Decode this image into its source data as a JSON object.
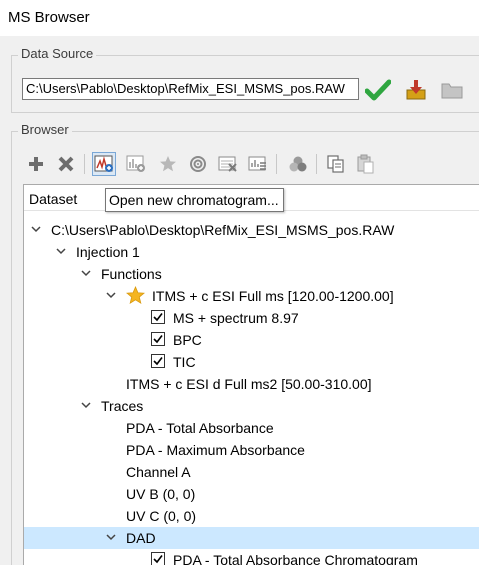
{
  "window": {
    "title": "MS Browser"
  },
  "data_source": {
    "legend": "Data Source",
    "path_value": "C:\\Users\\Pablo\\Desktop\\RefMix_ESI_MSMS_pos.RAW",
    "buttons": [
      {
        "icon": "checkmark-icon",
        "color": "#2fa640"
      },
      {
        "icon": "import-icon",
        "color": "#c0392b"
      },
      {
        "icon": "folder-icon",
        "color": "#b9b9b9"
      }
    ]
  },
  "browser": {
    "legend": "Browser",
    "toolbar": [
      {
        "icon": "add-icon"
      },
      {
        "icon": "remove-icon"
      },
      {
        "icon": "open-chromatogram-icon",
        "active": true
      },
      {
        "icon": "add-spectrum-icon"
      },
      {
        "icon": "star-icon"
      },
      {
        "icon": "target-icon"
      },
      {
        "icon": "delete-table-icon"
      },
      {
        "icon": "spectrum-list-icon"
      },
      {
        "icon": "group-icon"
      },
      {
        "icon": "copy-icon"
      },
      {
        "icon": "paste-icon"
      }
    ],
    "tooltip": "Open new chromatogram...",
    "tree": {
      "header": "Dataset",
      "nodes": [
        {
          "label": "C:\\Users\\Pablo\\Desktop\\RefMix_ESI_MSMS_pos.RAW",
          "expanded": true
        },
        {
          "label": "Injection 1",
          "expanded": true
        },
        {
          "label": "Functions",
          "expanded": true
        },
        {
          "label": "ITMS + c ESI Full ms [120.00-1200.00]",
          "expanded": true,
          "starred": true
        },
        {
          "label": "MS + spectrum 8.97",
          "checked": true
        },
        {
          "label": "BPC",
          "checked": true
        },
        {
          "label": "TIC",
          "checked": true
        },
        {
          "label": "ITMS + c ESI d Full ms2 [50.00-310.00]"
        },
        {
          "label": "Traces",
          "expanded": true
        },
        {
          "label": "PDA - Total Absorbance"
        },
        {
          "label": "PDA - Maximum Absorbance"
        },
        {
          "label": "Channel A"
        },
        {
          "label": "UV B (0, 0)"
        },
        {
          "label": "UV C (0, 0)"
        },
        {
          "label": "DAD",
          "expanded": true,
          "selected": true
        },
        {
          "label": "PDA - Total Absorbance Chromatogram",
          "checked": true
        }
      ]
    }
  }
}
